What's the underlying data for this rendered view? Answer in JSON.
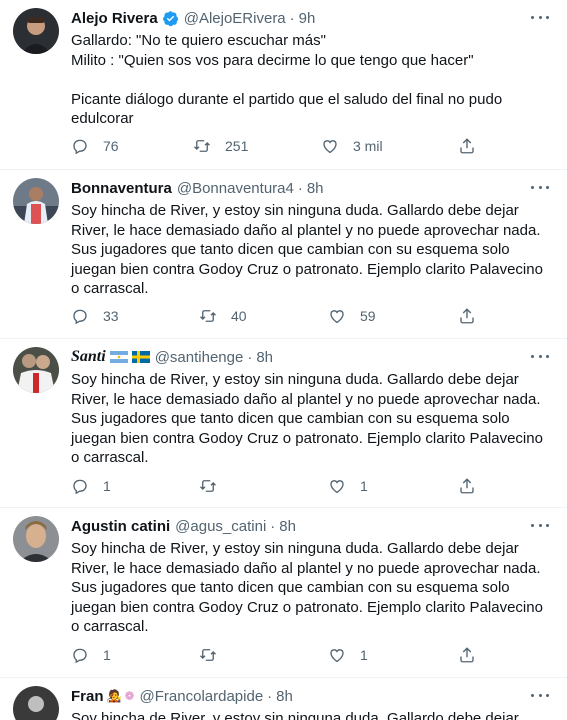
{
  "tweets": [
    {
      "name": "Alejo Rivera",
      "handle": "@AlejoERivera",
      "time": "9h",
      "verified": true,
      "lines": [
        "Gallardo: \"No te quiero escuchar más\"",
        "Milito : \"Quien sos vos para decirme lo que tengo que hacer\"",
        "",
        "Picante diálogo durante el partido que el saludo del final no pudo",
        "edulcorar"
      ],
      "replies": "76",
      "retweets": "251",
      "likes": "3 mil"
    },
    {
      "name": "Bonnaventura",
      "handle": "@Bonnaventura4",
      "time": "8h",
      "lines": [
        "Soy hincha de River, y estoy sin ninguna duda. Gallardo debe dejar",
        "River, le hace demasiado daño al plantel y no puede aprovechar nada.",
        "Sus jugadores que tanto dicen que cambian con su esquema solo",
        "juegan bien contra Godoy Cruz o patronato. Ejemplo clarito Palavecino",
        "o carrascal."
      ],
      "replies": "33",
      "retweets": "40",
      "likes": "59"
    },
    {
      "name": "Santi",
      "handle": "@santihenge",
      "time": "8h",
      "flags": [
        "argentina-flag",
        "sweden-flag"
      ],
      "lines": [
        "Soy hincha de River, y estoy sin ninguna duda. Gallardo debe dejar",
        "River, le hace demasiado daño al plantel y no puede aprovechar nada.",
        "Sus jugadores que tanto dicen que cambian con su esquema solo",
        "juegan bien contra Godoy Cruz o patronato. Ejemplo clarito Palavecino",
        "o carrascal."
      ],
      "replies": "1",
      "retweets": "",
      "likes": "1"
    },
    {
      "name": "Agustin catini",
      "handle": "@agus_catini",
      "time": "8h",
      "lines": [
        "Soy hincha de River, y estoy sin ninguna duda. Gallardo debe dejar",
        "River, le hace demasiado daño al plantel y no puede aprovechar nada.",
        "Sus jugadores que tanto dicen que cambian con su esquema solo",
        "juegan bien contra Godoy Cruz o patronato. Ejemplo clarito Palavecino",
        "o carrascal."
      ],
      "replies": "1",
      "retweets": "",
      "likes": "1"
    },
    {
      "name": "Fran",
      "handle": "@Francolardapide",
      "time": "8h",
      "lines": [
        "Soy hincha de River, y estoy sin ninguna duda. Gallardo debe dejar"
      ]
    }
  ],
  "colors": {
    "text": "#0f1419",
    "muted": "#536471",
    "verified": "#1d9bf0",
    "border": "#eff3f4"
  }
}
